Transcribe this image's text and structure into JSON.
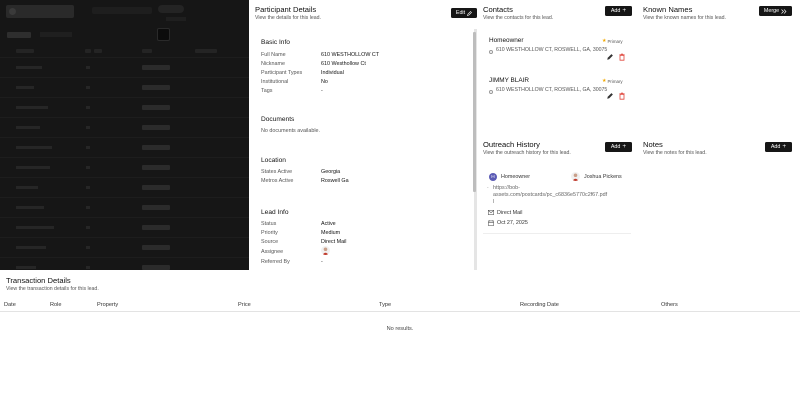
{
  "participant": {
    "title": "Participant Details",
    "subtitle": "View the details for this lead.",
    "edit_label": "Edit",
    "basic_info": {
      "title": "Basic Info",
      "rows": [
        {
          "label": "Full Name",
          "value": "610 WESTHOLLOW CT"
        },
        {
          "label": "Nickname",
          "value": "610 Westhollow Ct"
        },
        {
          "label": "Participant Types",
          "value": "Individual"
        },
        {
          "label": "Institutional",
          "value": "No"
        },
        {
          "label": "Tags",
          "value": "-"
        }
      ]
    },
    "documents": {
      "title": "Documents",
      "empty": "No documents available."
    },
    "location": {
      "title": "Location",
      "rows": [
        {
          "label": "States Active",
          "value": "Georgia"
        },
        {
          "label": "Metros Active",
          "value": "Roswell Ga"
        }
      ]
    },
    "lead_info": {
      "title": "Lead Info",
      "rows": [
        {
          "label": "Status",
          "value": "Active"
        },
        {
          "label": "Priority",
          "value": "Medium"
        },
        {
          "label": "Source",
          "value": "Direct Mail"
        },
        {
          "label": "Assignee",
          "value": ""
        },
        {
          "label": "Referred By",
          "value": "-"
        }
      ]
    }
  },
  "contacts": {
    "title": "Contacts",
    "subtitle": "View the contacts for this lead.",
    "add_label": "Add",
    "primary_label": "Primary",
    "items": [
      {
        "name": "Homeowner",
        "address": "610 WESTHOLLOW CT, ROSWELL, GA, 30075"
      },
      {
        "name": "JIMMY BLAIR",
        "address": "610 WESTHOLLOW CT, ROSWELL, GA, 30075"
      }
    ]
  },
  "known_names": {
    "title": "Known Names",
    "subtitle": "View the known names for this lead.",
    "merge_label": "Merge"
  },
  "outreach": {
    "title": "Outreach History",
    "subtitle": "View the outreach history for this lead.",
    "add_label": "Add",
    "entry": {
      "avatar_letter": "H",
      "contact": "Homeowner",
      "agent": "Joshua Pickens",
      "link": "https://bob-assets.com/postcards/pc_c6836e5770c2f67.pdf",
      "link_line1": "https://bob-",
      "link_line2": "assets.com/postcards/pc_c6836e5770c2f67.pdf",
      "link_line3": "l",
      "channel": "Direct Mail",
      "date": "Oct 27, 2025"
    }
  },
  "notes": {
    "title": "Notes",
    "subtitle": "View the notes for this lead.",
    "add_label": "Add"
  },
  "transactions": {
    "title": "Transaction Details",
    "subtitle": "View the transaction details for this lead.",
    "columns": [
      "Date",
      "Role",
      "Property",
      "Price",
      "Type",
      "Recording Date",
      "Others"
    ],
    "empty": "No results."
  },
  "colors": {
    "button_bg": "#161616",
    "avatar": "#5b5bb5",
    "delete_icon": "#e0463c",
    "primary_star": "#f2a900"
  }
}
